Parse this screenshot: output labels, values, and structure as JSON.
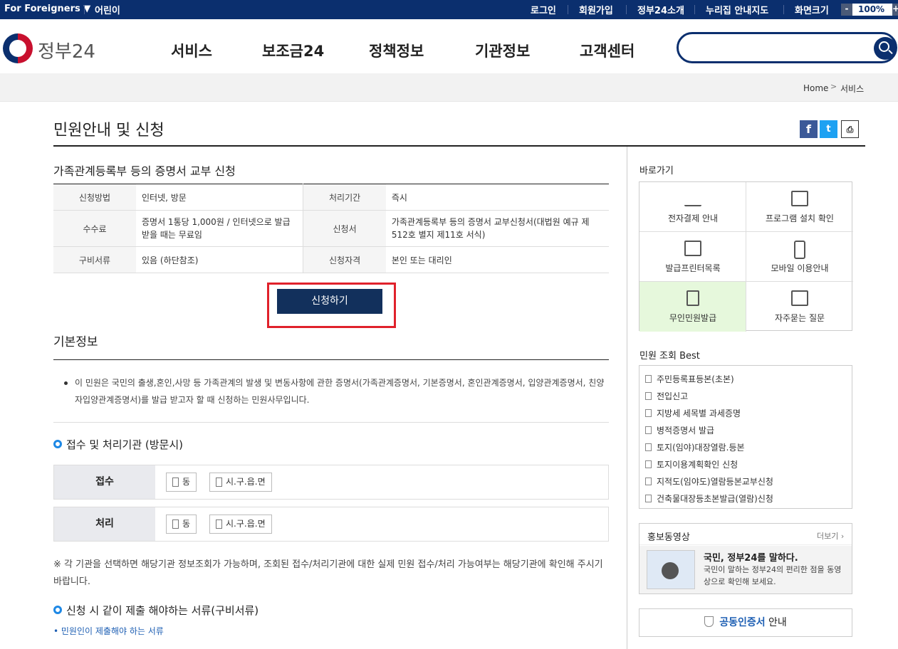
{
  "topbar": {
    "foreigners": "For Foreigners ▼",
    "kids": "어린이",
    "login": "로그인",
    "signup": "회원가입",
    "about": "정부24소개",
    "nuri": "누리집 안내지도",
    "screen": "화면크기",
    "zoom_minus": "-",
    "zoom_value": "100%",
    "zoom_plus": "+"
  },
  "header": {
    "logo": "정부24",
    "nav": [
      "서비스",
      "보조금24",
      "정책정보",
      "기관정보",
      "고객센터"
    ],
    "search_placeholder": ""
  },
  "breadcrumb": {
    "home": "Home",
    "arrow": ">",
    "current": "서비스"
  },
  "page": {
    "title": "민원안내 및 신청",
    "subtitle": "가족관계등록부 등의 증명서 교부 신청",
    "info": {
      "method_label": "신청방법",
      "method": "인터넷, 방문",
      "period_label": "처리기간",
      "period": "즉시",
      "fee_label": "수수료",
      "fee": "증명서 1통당 1,000원 / 인터넷으로 발급받을 때는 무료임",
      "form_label": "신청서",
      "form": "가족관계등록부 등의 증명서 교부신청서(대법원 예규 제512호 별지 제11호 서식)",
      "docs_label": "구비서류",
      "docs": "있음 (하단참조)",
      "qual_label": "신청자격",
      "qual": "본인 또는 대리인"
    },
    "apply_button": "신청하기",
    "basic_title": "기본정보",
    "basic_desc": "이 민원은 국민의 출생,혼인,사망 등 가족관계의 발생 및 변동사항에 관한 증명서(가족관계증명서, 기본증명서, 혼인관계증명서, 입양관계증명서, 친양자입양관계증명서)를 발급 받고자 할 때 신청하는 민원사무입니다.",
    "agency_title": "접수 및 처리기관 (방문시)",
    "receive_label": "접수",
    "process_label": "처리",
    "chip1": "동",
    "chip2": "시.구.읍.면",
    "note": "※ 각 기관을 선택하면 해당기관 정보조회가 가능하며, 조회된 접수/처리기관에 대한 실제 민원 접수/처리 가능여부는 해당기관에 확인해 주시기 바랍니다.",
    "docs_title": "신청 시 같이 제출 해야하는 서류(구비서류)",
    "docs_link": "• 민원인이 제출해야 하는 서류"
  },
  "sidebar": {
    "quick_title": "바로가기",
    "quick": [
      "전자결제 안내",
      "프로그램 설치 확인",
      "발급프린터목록",
      "모바일 이용안내",
      "무인민원발급",
      "자주묻는 질문"
    ],
    "best_title": "민원 조회 Best",
    "best": [
      "주민등록표등본(초본)",
      "전입신고",
      "지방세 세목별 과세증명",
      "병적증명서 발급",
      "토지(임야)대장열람.등본",
      "토지이용계획확인 신청",
      "지적도(임야도)열람등본교부신청",
      "건축물대장등초본발급(열람)신청"
    ],
    "promo_title": "홍보동영상",
    "promo_more": "더보기 ›",
    "promo_headline": "국민, 정부24를 말하다.",
    "promo_text": "국민이 말하는 정부24의 편리한 점을 동영상으로 확인해 보세요.",
    "cert_prefix": "공동인증서",
    "cert_suffix": " 안내"
  },
  "colors": {
    "navy": "#0b2f6e",
    "button": "#12305c",
    "highlight_red": "#e0212b",
    "accent_blue": "#1e88e5"
  }
}
